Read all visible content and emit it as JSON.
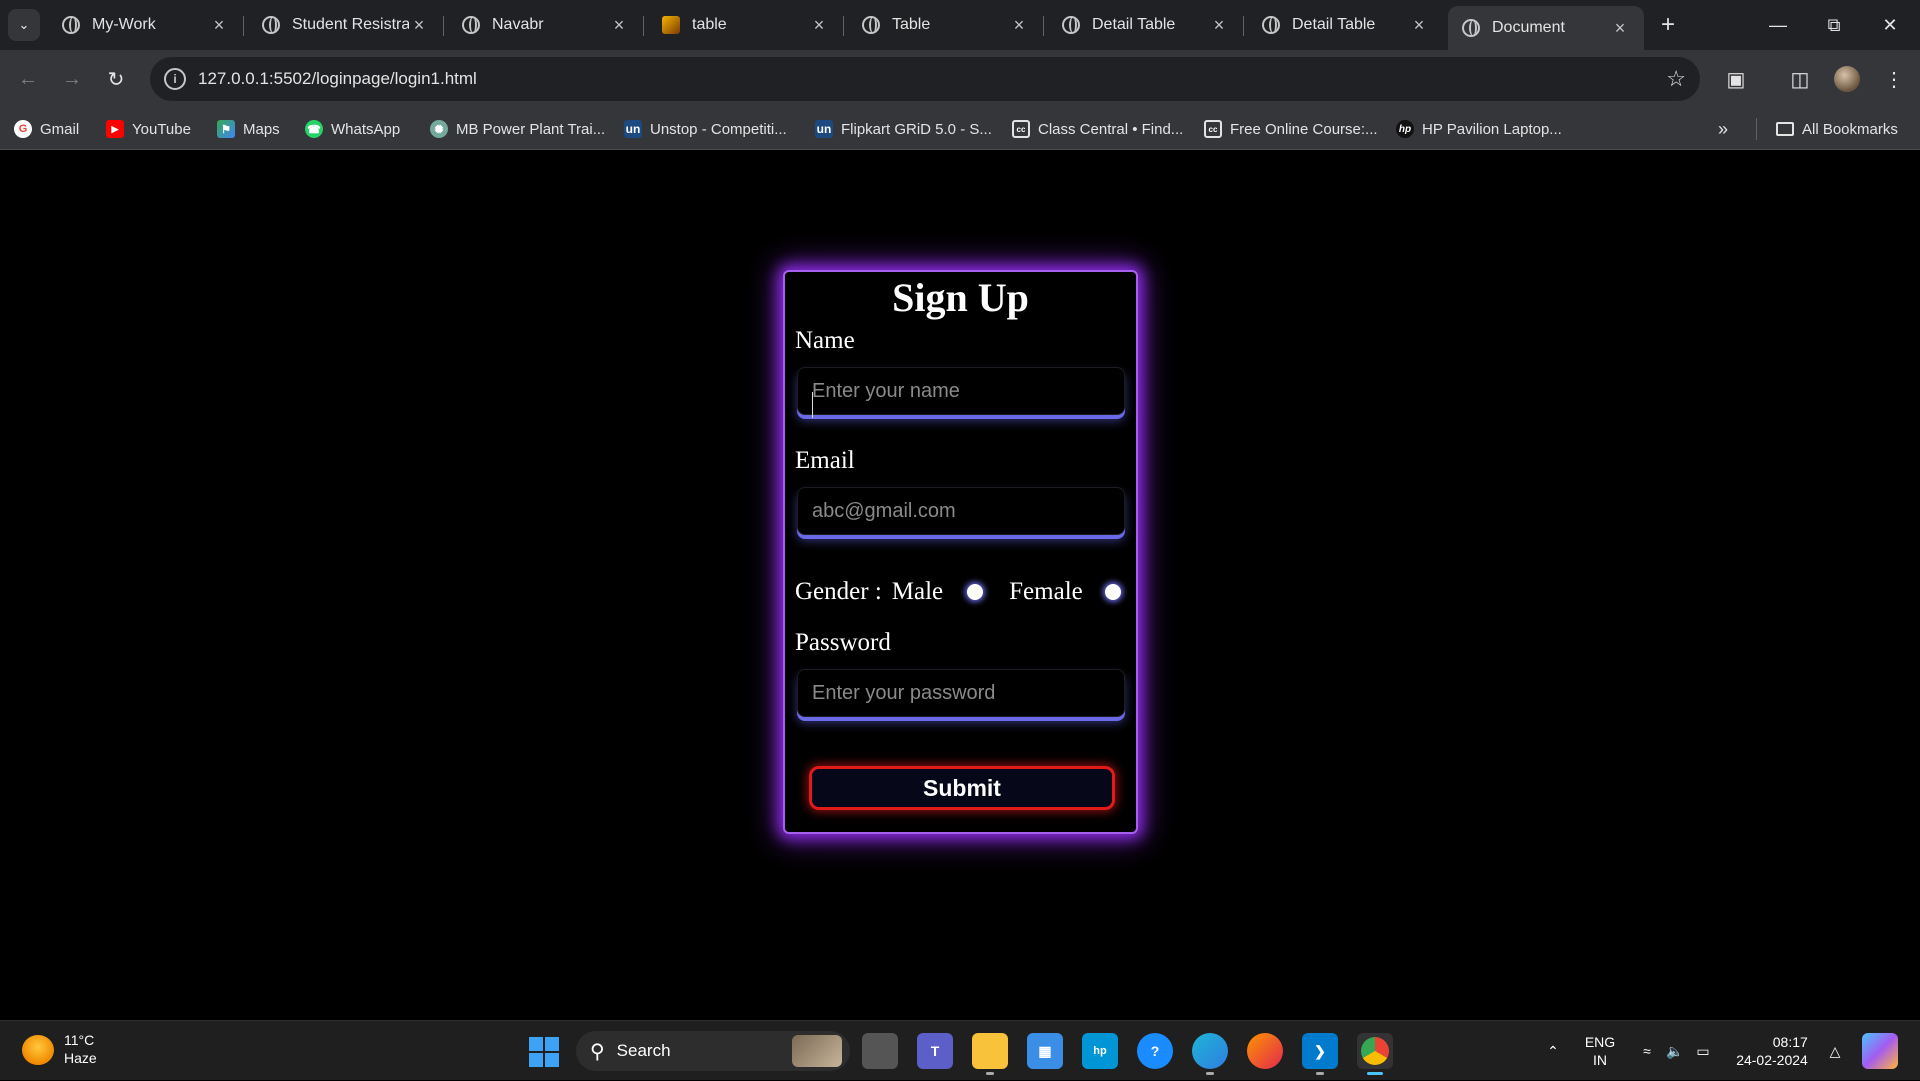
{
  "browser": {
    "tabs": [
      {
        "title": "My-Work",
        "active": false
      },
      {
        "title": "Student Resistrat",
        "active": false
      },
      {
        "title": "Navabr",
        "active": false
      },
      {
        "title": "table",
        "active": false
      },
      {
        "title": "Table",
        "active": false
      },
      {
        "title": "Detail Table",
        "active": false
      },
      {
        "title": "Detail Table",
        "active": false
      },
      {
        "title": "Document",
        "active": true
      }
    ],
    "url": "127.0.0.1:5502/loginpage/login1.html",
    "bookmarks": [
      {
        "label": "Gmail",
        "icon": "gmail-icon"
      },
      {
        "label": "YouTube",
        "icon": "youtube-icon"
      },
      {
        "label": "Maps",
        "icon": "maps-icon"
      },
      {
        "label": "WhatsApp",
        "icon": "whatsapp-icon"
      },
      {
        "label": "MB Power Plant Trai...",
        "icon": "chatgpt-icon"
      },
      {
        "label": "Unstop - Competiti...",
        "icon": "unstop-icon"
      },
      {
        "label": "Flipkart GRiD 5.0 - S...",
        "icon": "unstop-icon"
      },
      {
        "label": "Class Central • Find...",
        "icon": "classcentral-icon"
      },
      {
        "label": "Free Online Course:...",
        "icon": "classcentral-icon"
      },
      {
        "label": "HP Pavilion Laptop...",
        "icon": "hp-icon"
      }
    ],
    "all_bookmarks": "All Bookmarks"
  },
  "form": {
    "title": "Sign Up",
    "name_label": "Name",
    "name_placeholder": "Enter your name",
    "email_label": "Email",
    "email_placeholder": "abc@gmail.com",
    "gender_label": "Gender :",
    "gender_options": [
      "Male",
      "Female"
    ],
    "password_label": "Password",
    "password_placeholder": "Enter your password",
    "submit_label": "Submit"
  },
  "colors": {
    "card_glow": "#8a2be2",
    "input_shadow": "#6a6ae8",
    "submit_border": "#e11a1a"
  },
  "taskbar": {
    "temperature": "11°C",
    "weather": "Haze",
    "search_label": "Search",
    "lang_primary": "ENG",
    "lang_secondary": "IN",
    "time": "08:17",
    "date": "24-02-2024"
  }
}
